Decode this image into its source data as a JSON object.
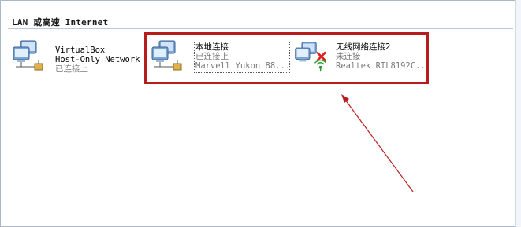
{
  "section": {
    "title": "LAN 或高速 Internet"
  },
  "connections": [
    {
      "name_line1": "VirtualBox",
      "name_line2": "Host-Only Network",
      "status": "已连接上",
      "icon": "network-connection-icon"
    },
    {
      "name": "本地连接",
      "status": "已连接上",
      "device": "Marvell Yukon 88...",
      "icon": "network-connection-icon"
    },
    {
      "name": "无线网络连接2",
      "status": "未连接",
      "device": "Realtek RTL8192C...",
      "icon": "wireless-disconnected-icon"
    }
  ],
  "colors": {
    "highlight": "#b81d1d",
    "arrow": "#b81d1d",
    "status_text": "#7a7a7a"
  }
}
